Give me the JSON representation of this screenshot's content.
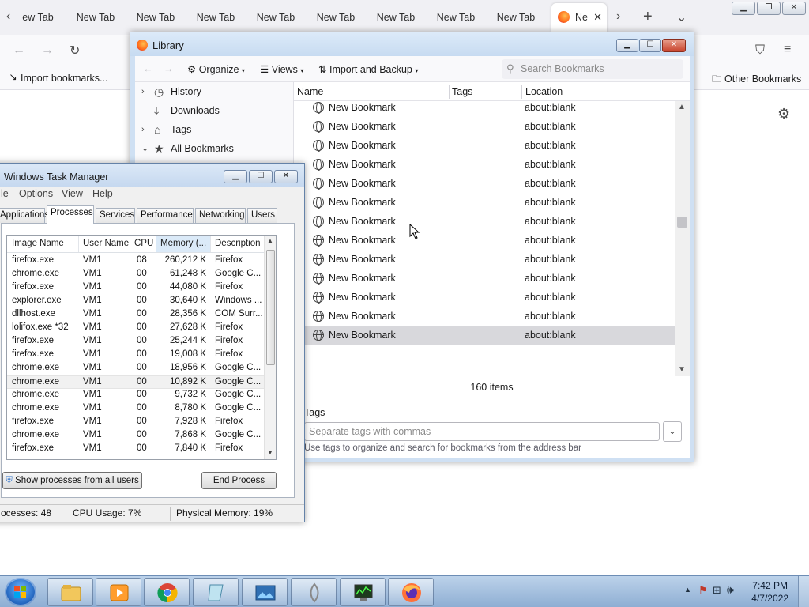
{
  "browser": {
    "tabs": [
      "ew Tab",
      "New Tab",
      "New Tab",
      "New Tab",
      "New Tab",
      "New Tab",
      "New Tab",
      "New Tab",
      "New Tab"
    ],
    "active_tab": "Ne",
    "bookmarks_toolbar": {
      "import": "Import bookmarks...",
      "other": "Other Bookmarks"
    }
  },
  "library": {
    "title": "Library",
    "toolbar": {
      "organize": "Organize",
      "views": "Views",
      "import_backup": "Import and Backup"
    },
    "search_placeholder": "Search Bookmarks",
    "sidebar": [
      {
        "label": "History",
        "icon": "clock-icon"
      },
      {
        "label": "Downloads",
        "icon": "download-icon"
      },
      {
        "label": "Tags",
        "icon": "tag-icon"
      },
      {
        "label": "All Bookmarks",
        "icon": "star-icon"
      }
    ],
    "columns": {
      "name": "Name",
      "tags": "Tags",
      "location": "Location"
    },
    "rows": [
      {
        "name": "New Bookmark",
        "location": "about:blank"
      },
      {
        "name": "New Bookmark",
        "location": "about:blank"
      },
      {
        "name": "New Bookmark",
        "location": "about:blank"
      },
      {
        "name": "New Bookmark",
        "location": "about:blank"
      },
      {
        "name": "New Bookmark",
        "location": "about:blank"
      },
      {
        "name": "New Bookmark",
        "location": "about:blank"
      },
      {
        "name": "New Bookmark",
        "location": "about:blank"
      },
      {
        "name": "New Bookmark",
        "location": "about:blank"
      },
      {
        "name": "New Bookmark",
        "location": "about:blank"
      },
      {
        "name": "New Bookmark",
        "location": "about:blank"
      },
      {
        "name": "New Bookmark",
        "location": "about:blank"
      },
      {
        "name": "New Bookmark",
        "location": "about:blank"
      },
      {
        "name": "New Bookmark",
        "location": "about:blank"
      }
    ],
    "item_count": "160 items",
    "tags_label": "Tags",
    "tags_placeholder": "Separate tags with commas",
    "tags_help": "Use tags to organize and search for bookmarks from the address bar"
  },
  "taskmgr": {
    "title": "Windows Task Manager",
    "menu": [
      "le",
      "Options",
      "View",
      "Help"
    ],
    "tabs": [
      "Applications",
      "Processes",
      "Services",
      "Performance",
      "Networking",
      "Users"
    ],
    "columns": {
      "image": "Image Name",
      "user": "User Name",
      "cpu": "CPU",
      "memory": "Memory (...",
      "desc": "Description"
    },
    "rows": [
      {
        "image": "firefox.exe",
        "user": "VM1",
        "cpu": "08",
        "memory": "260,212 K",
        "desc": "Firefox"
      },
      {
        "image": "chrome.exe",
        "user": "VM1",
        "cpu": "00",
        "memory": "61,248 K",
        "desc": "Google C..."
      },
      {
        "image": "firefox.exe",
        "user": "VM1",
        "cpu": "00",
        "memory": "44,080 K",
        "desc": "Firefox"
      },
      {
        "image": "explorer.exe",
        "user": "VM1",
        "cpu": "00",
        "memory": "30,640 K",
        "desc": "Windows ..."
      },
      {
        "image": "dllhost.exe",
        "user": "VM1",
        "cpu": "00",
        "memory": "28,356 K",
        "desc": "COM Surr..."
      },
      {
        "image": "lolifox.exe *32",
        "user": "VM1",
        "cpu": "00",
        "memory": "27,628 K",
        "desc": "Firefox"
      },
      {
        "image": "firefox.exe",
        "user": "VM1",
        "cpu": "00",
        "memory": "25,244 K",
        "desc": "Firefox"
      },
      {
        "image": "firefox.exe",
        "user": "VM1",
        "cpu": "00",
        "memory": "19,008 K",
        "desc": "Firefox"
      },
      {
        "image": "chrome.exe",
        "user": "VM1",
        "cpu": "00",
        "memory": "18,956 K",
        "desc": "Google C..."
      },
      {
        "image": "chrome.exe",
        "user": "VM1",
        "cpu": "00",
        "memory": "10,892 K",
        "desc": "Google C..."
      },
      {
        "image": "chrome.exe",
        "user": "VM1",
        "cpu": "00",
        "memory": "9,732 K",
        "desc": "Google C..."
      },
      {
        "image": "chrome.exe",
        "user": "VM1",
        "cpu": "00",
        "memory": "8,780 K",
        "desc": "Google C..."
      },
      {
        "image": "firefox.exe",
        "user": "VM1",
        "cpu": "00",
        "memory": "7,928 K",
        "desc": "Firefox"
      },
      {
        "image": "chrome.exe",
        "user": "VM1",
        "cpu": "00",
        "memory": "7,868 K",
        "desc": "Google C..."
      },
      {
        "image": "firefox.exe",
        "user": "VM1",
        "cpu": "00",
        "memory": "7,840 K",
        "desc": "Firefox"
      }
    ],
    "show_all_label": "Show processes from all users",
    "end_process_label": "End Process",
    "status": {
      "processes": "ocesses: 48",
      "cpu": "CPU Usage: 7%",
      "memory": "Physical Memory: 19%"
    }
  },
  "taskbar": {
    "apps": [
      "explorer-icon",
      "media-player-icon",
      "chrome-icon",
      "notepad-icon",
      "picture-viewer-icon",
      "app-icon",
      "task-manager-icon",
      "firefox-icon"
    ],
    "time": "7:42 PM",
    "date": "4/7/2022"
  }
}
